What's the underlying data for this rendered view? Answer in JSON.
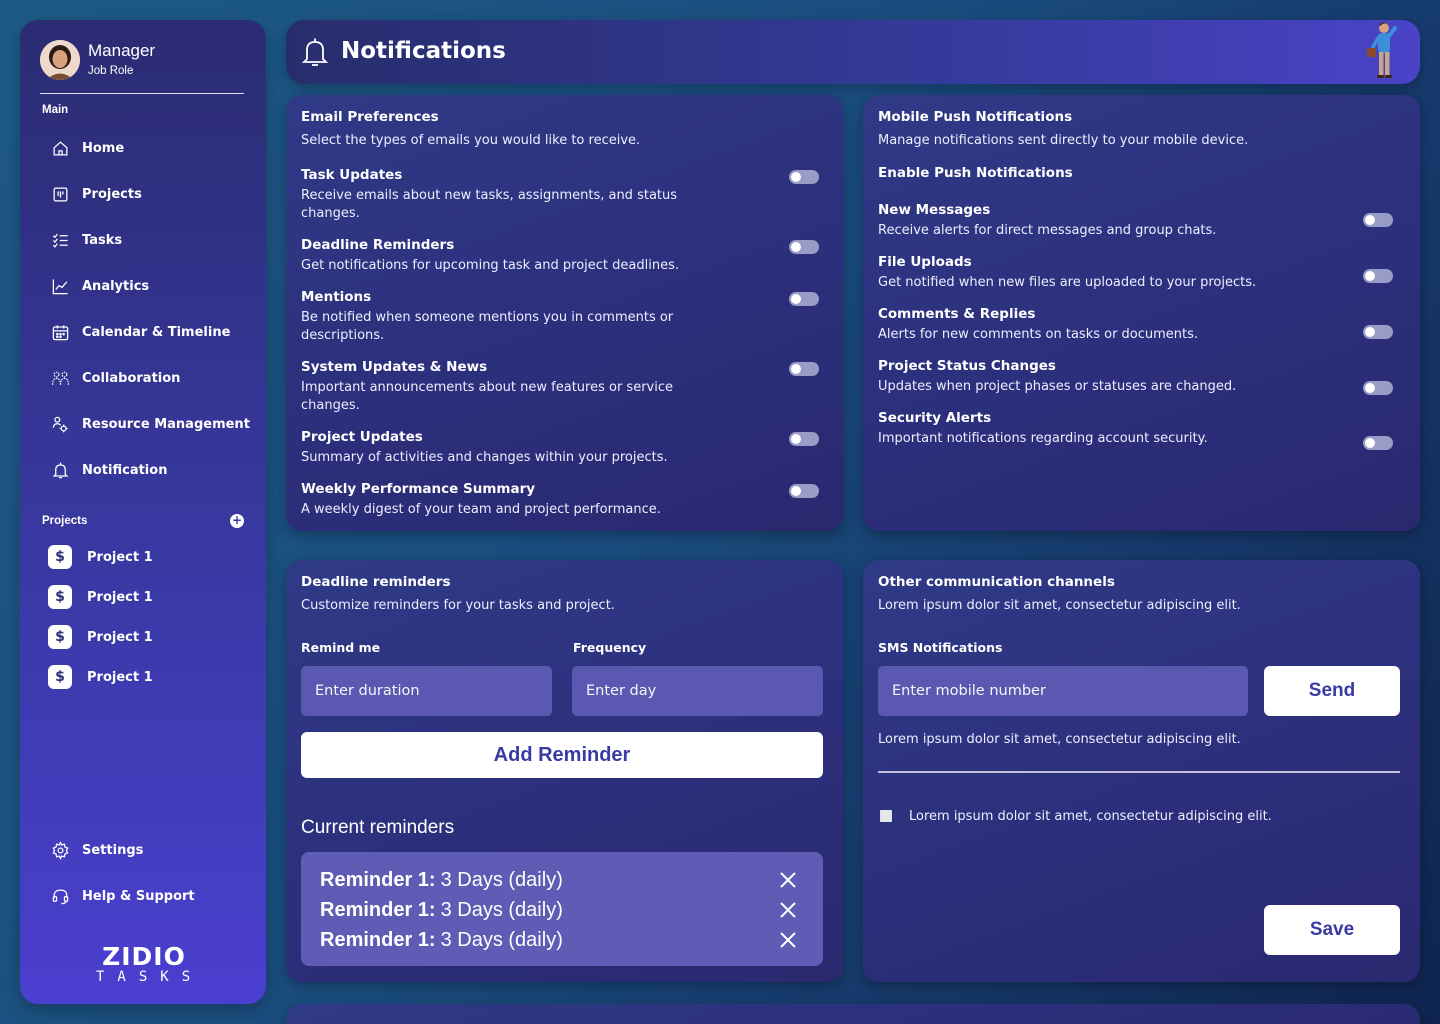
{
  "user": {
    "name": "Manager",
    "role": "Job Role"
  },
  "sidebar": {
    "main_label": "Main",
    "items": [
      {
        "label": "Home",
        "icon": "home-icon"
      },
      {
        "label": "Projects",
        "icon": "projects-icon"
      },
      {
        "label": "Tasks",
        "icon": "tasks-icon"
      },
      {
        "label": "Analytics",
        "icon": "analytics-icon"
      },
      {
        "label": "Calendar & Timeline",
        "icon": "calendar-icon"
      },
      {
        "label": "Collaboration",
        "icon": "collaboration-icon"
      },
      {
        "label": "Resource Management",
        "icon": "resource-icon"
      },
      {
        "label": "Notification",
        "icon": "bell-icon"
      }
    ],
    "projects_label": "Projects",
    "projects": [
      "Project 1",
      "Project 1",
      "Project 1",
      "Project 1"
    ],
    "bottom_items": [
      {
        "label": "Settings",
        "icon": "gear-icon"
      },
      {
        "label": "Help & Support",
        "icon": "headset-icon"
      }
    ],
    "logo_top": "ZIDIO",
    "logo_bottom": "TASKS"
  },
  "header": {
    "title": "Notifications"
  },
  "email_prefs": {
    "title": "Email Preferences",
    "subtitle": "Select the types of emails you would like to receive.",
    "options": [
      {
        "title": "Task Updates",
        "desc": "Receive emails about new tasks, assignments, and status changes.",
        "enabled": false
      },
      {
        "title": "Deadline Reminders",
        "desc": "Get notifications for upcoming task and project deadlines.",
        "enabled": false
      },
      {
        "title": "Mentions",
        "desc": "Be notified when someone mentions you in comments or descriptions.",
        "enabled": false
      },
      {
        "title": "System Updates & News",
        "desc": "Important announcements about new features or service changes.",
        "enabled": false
      },
      {
        "title": "Project Updates",
        "desc": "Summary of activities and changes within your projects.",
        "enabled": false
      },
      {
        "title": "Weekly Performance Summary",
        "desc": "A weekly digest of your team and project performance.",
        "enabled": false
      }
    ]
  },
  "push": {
    "title": "Mobile Push Notifications",
    "subtitle": "Manage notifications sent directly to your mobile device.",
    "enable_label": "Enable Push Notifications",
    "options": [
      {
        "title": "New Messages",
        "desc": "Receive alerts for direct messages and group chats.",
        "enabled": false
      },
      {
        "title": "File Uploads",
        "desc": "Get notified when new files are uploaded to your projects.",
        "enabled": false
      },
      {
        "title": "Comments & Replies",
        "desc": "Alerts for new comments on tasks or documents.",
        "enabled": false
      },
      {
        "title": "Project Status Changes",
        "desc": "Updates when project phases or statuses are changed.",
        "enabled": false
      },
      {
        "title": "Security Alerts",
        "desc": "Important notifications regarding account security.",
        "enabled": false
      }
    ]
  },
  "deadline": {
    "title": "Deadline reminders",
    "subtitle": "Customize reminders for your tasks and project.",
    "remind_label": "Remind me",
    "remind_placeholder": "Enter duration",
    "frequency_label": "Frequency",
    "frequency_placeholder": "Enter day",
    "add_button": "Add Reminder",
    "current_title": "Current reminders",
    "reminders": [
      {
        "label": "Reminder 1:",
        "value": "3 Days (daily)"
      },
      {
        "label": "Reminder 1:",
        "value": "3 Days (daily)"
      },
      {
        "label": "Reminder 1:",
        "value": "3 Days (daily)"
      }
    ]
  },
  "other": {
    "title": "Other communication channels",
    "subtitle": "Lorem ipsum dolor sit amet, consectetur adipiscing elit.",
    "sms_label": "SMS Notifications",
    "sms_placeholder": "Enter mobile number",
    "send_button": "Send",
    "note": "Lorem ipsum dolor sit amet, consectetur adipiscing elit.",
    "checkbox_label": "Lorem ipsum dolor sit amet, consectetur adipiscing elit.",
    "save_button": "Save"
  }
}
